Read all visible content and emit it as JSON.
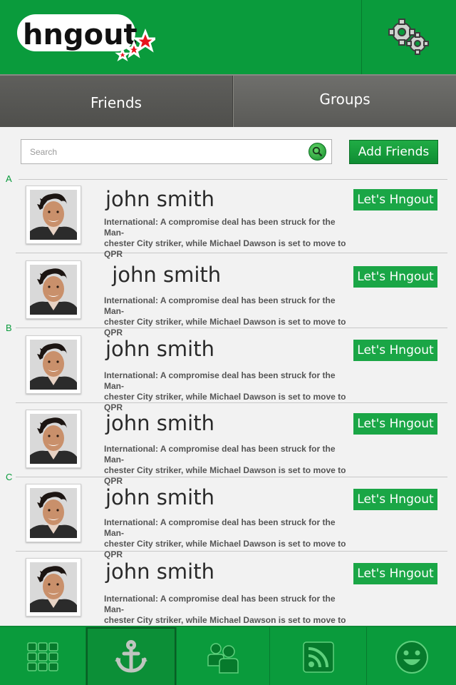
{
  "app": {
    "logo_text": "hngout"
  },
  "header": {
    "settings_icon": "gear-icon"
  },
  "tabs": [
    {
      "label": "Friends",
      "active": true
    },
    {
      "label": "Groups",
      "active": false
    }
  ],
  "search": {
    "placeholder": "Search",
    "value": ""
  },
  "add_friends_label": "Add Friends",
  "sections": [
    "A",
    "B",
    "C"
  ],
  "friends": [
    {
      "name": "john smith",
      "desc1": "International: A compromise deal has been struck for the Man-",
      "desc2": "chester City striker, while Michael Dawson is set to move to QPR",
      "action": "Let's Hngout"
    },
    {
      "name": " john smith",
      "desc1": "International: A compromise deal has been struck for the Man-",
      "desc2": "chester City striker, while Michael Dawson is set to move to QPR",
      "action": "Let's Hngout"
    },
    {
      "name": "john smith",
      "desc1": "International: A compromise deal has been struck for the Man-",
      "desc2": "chester City striker, while Michael Dawson is set to move to QPR",
      "action": "Let's Hngout"
    },
    {
      "name": "john smith",
      "desc1": "International: A compromise deal has been struck for the Man-",
      "desc2": "chester City striker, while Michael Dawson is set to move to QPR",
      "action": "Let's Hngout"
    },
    {
      "name": "john smith",
      "desc1": "International: A compromise deal has been struck for the Man-",
      "desc2": "chester City striker, while Michael Dawson is set to move to QPR",
      "action": "Let's Hngout"
    },
    {
      "name": "john smith",
      "desc1": "International: A compromise deal has been struck for the Man-",
      "desc2": "chester City striker, while Michael Dawson is set to move to QPR",
      "action": "Let's Hngout"
    }
  ],
  "bottom_nav": [
    "grid-icon",
    "anchor-icon",
    "people-icon",
    "rss-icon",
    "smiley-icon"
  ],
  "colors": {
    "brand_green": "#0a9b3c",
    "button_green": "#1aa646",
    "tab_gray": "#5f5f5c"
  }
}
